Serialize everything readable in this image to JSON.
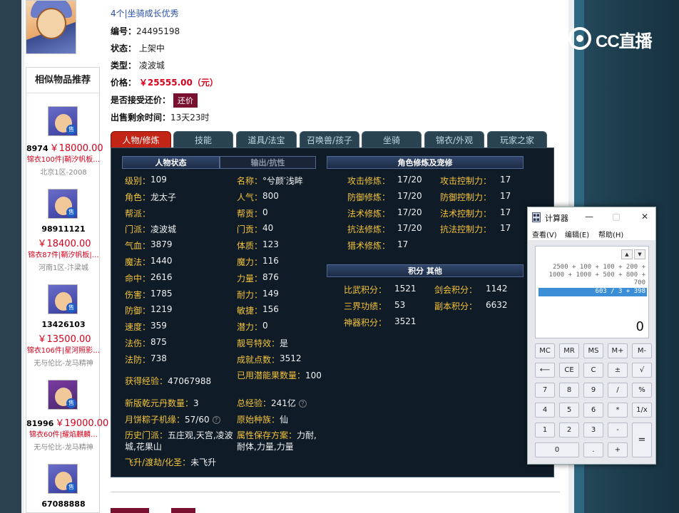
{
  "listing": {
    "grade_prefix": "4个",
    "grade_text": "|坐骑成长优秀",
    "id_label": "编号：",
    "id_value": "24495198",
    "status_label": "状态：",
    "status_value": "上架中",
    "type_label": "类型：",
    "type_value": "凌波城",
    "price_label": "价格：",
    "price_value": "￥25555.00（元）",
    "counter_label": "是否接受还价：",
    "counter_button": "还价",
    "time_label": "出售剩余时间：",
    "time_value": "13天23时"
  },
  "similar": {
    "title": "相似物品推荐",
    "items": [
      {
        "id": "8974",
        "price": "￥18000.00",
        "gear": "锦衣100件|鞘汐帆板…",
        "server": "北京1区-2008"
      },
      {
        "id": "98911121",
        "price": "￥18400.00",
        "gear": "锦衣87件|鞘汐帆板|…",
        "server": "河南1区-汴梁城"
      },
      {
        "id": "13426103",
        "price": "￥13500.00",
        "gear": "锦衣106件|星河照影…",
        "server": "无与伦比-龙马精神"
      },
      {
        "id": "81996",
        "price": "￥19000.00",
        "gear": "锦衣60件|耀焰麒麟…",
        "server": "无与伦比-龙马精神"
      },
      {
        "id": "67088888",
        "price": "",
        "gear": "",
        "server": ""
      }
    ]
  },
  "tabs": [
    "人物/修炼",
    "技能",
    "道具/法宝",
    "召唤兽/孩子",
    "坐骑",
    "锦衣/外观",
    "玩家之家"
  ],
  "panel": {
    "header_status": "人物状态",
    "header_output": "输出/抗性",
    "header_cultivation": "角色修炼及宠修",
    "header_points": "积分  其他",
    "left_stats": [
      {
        "k": "级别：",
        "v": "109"
      },
      {
        "k": "角色：",
        "v": "龙太子"
      },
      {
        "k": "帮派：",
        "v": ""
      },
      {
        "k": "门派：",
        "v": "凌波城"
      },
      {
        "k": "气血：",
        "v": "3879"
      },
      {
        "k": "魔法：",
        "v": "1440"
      },
      {
        "k": "命中：",
        "v": "2616"
      },
      {
        "k": "伤害：",
        "v": "1785"
      },
      {
        "k": "防御：",
        "v": "1219"
      },
      {
        "k": "速度：",
        "v": "359"
      },
      {
        "k": "法伤：",
        "v": "875"
      },
      {
        "k": "法防：",
        "v": "738"
      }
    ],
    "mid_stats": [
      {
        "k": "名称：",
        "v": "°兮颜′浅眸"
      },
      {
        "k": "人气：",
        "v": "800"
      },
      {
        "k": "帮贡：",
        "v": "0"
      },
      {
        "k": "门贡：",
        "v": "40"
      },
      {
        "k": "体质：",
        "v": "123"
      },
      {
        "k": "魔力：",
        "v": "116"
      },
      {
        "k": "力量：",
        "v": "876"
      },
      {
        "k": "耐力：",
        "v": "149"
      },
      {
        "k": "敏捷：",
        "v": "156"
      },
      {
        "k": "潜力：",
        "v": "0"
      },
      {
        "k": "靓号特效：",
        "v": "是"
      },
      {
        "k": "成就点数：",
        "v": "3512"
      }
    ],
    "exp_label": "获得经验：",
    "exp_value": "47067988",
    "used_fruit_label": "已用潜能果数量：",
    "used_fruit_value": "100",
    "pill_label": "新版乾元丹数量：",
    "pill_value": "3",
    "total_exp_label": "总经验：",
    "total_exp_value": "241亿",
    "mooncake_label": "月饼粽子机缘：",
    "mooncake_value": "57/60",
    "race_label": "原始种族：",
    "race_value": "仙",
    "hist_sect_label": "历史门派：",
    "hist_sect_value": "五庄观,天宫,凌波城,花果山",
    "attr_save_label": "属性保存方案：",
    "attr_save_value": "力耐,耐体,力量,力量",
    "ascend_label": "飞升/渡劫/化圣：",
    "ascend_value": "未飞升",
    "cultivation": [
      {
        "k": "攻击修炼：",
        "v": "17/20"
      },
      {
        "k": "防御修炼：",
        "v": "17/20"
      },
      {
        "k": "法术修炼：",
        "v": "17/20"
      },
      {
        "k": "抗法修炼：",
        "v": "17/20"
      },
      {
        "k": "猎术修炼：",
        "v": "17"
      }
    ],
    "control": [
      {
        "k": "攻击控制力：",
        "v": "17"
      },
      {
        "k": "防御控制力：",
        "v": "17"
      },
      {
        "k": "法术控制力：",
        "v": "17"
      },
      {
        "k": "抗法控制力：",
        "v": "17"
      }
    ],
    "points": [
      {
        "k": "比武积分：",
        "v": "1521"
      },
      {
        "k": "三界功绩：",
        "v": "53"
      },
      {
        "k": "神器积分：",
        "v": "3521"
      }
    ],
    "points_right": [
      {
        "k": "剑会积分：",
        "v": "1142"
      },
      {
        "k": "副本积分：",
        "v": "6632"
      }
    ]
  },
  "calculator": {
    "title": "计算器",
    "menu": [
      "查看(V)",
      "编辑(E)",
      "帮助(H)"
    ],
    "history": [
      "2500 + 100 + 100 + 200 +",
      "1000 + 1000 + 500 + 800 +",
      "700"
    ],
    "history_selected": "603 / 3 + 398",
    "result": "0",
    "buttons": {
      "mc": "MC",
      "mr": "MR",
      "ms": "MS",
      "mplus": "M+",
      "mminus": "M-",
      "back": "⟵",
      "ce": "CE",
      "c": "C",
      "pm": "±",
      "sqrt": "√",
      "n7": "7",
      "n8": "8",
      "n9": "9",
      "div": "/",
      "pct": "%",
      "n4": "4",
      "n5": "5",
      "n6": "6",
      "mul": "*",
      "recip": "1/x",
      "n1": "1",
      "n2": "2",
      "n3": "3",
      "sub": "-",
      "eq": "=",
      "n0": "0",
      "dot": ".",
      "add": "+"
    }
  },
  "brand": {
    "logo_text": "CC直播"
  },
  "colors": {
    "price_red": "#d6001c",
    "gold_label": "#f3c23a",
    "panel_bg": "#0f1c28",
    "active_tab": "#c22416"
  }
}
